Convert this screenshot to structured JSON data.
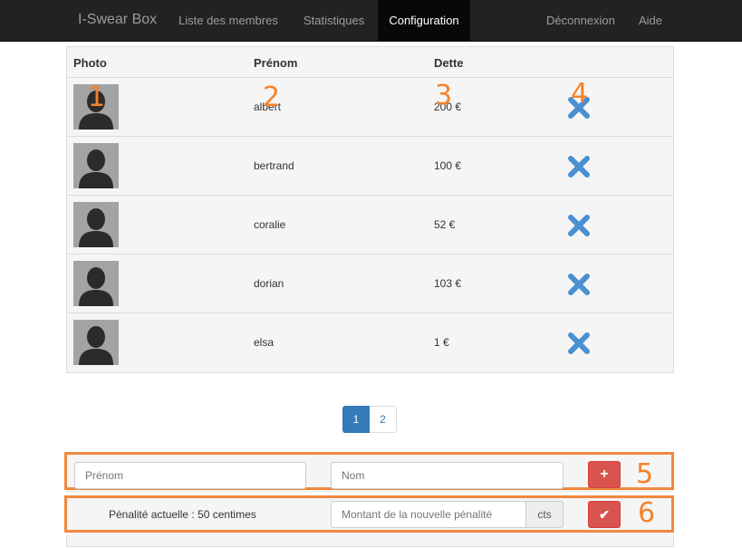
{
  "navbar": {
    "brand": "I-Swear Box",
    "items": [
      "Liste des membres",
      "Statistiques",
      "Configuration"
    ],
    "active": "Configuration",
    "right_items": [
      "Déconnexion",
      "Aide"
    ]
  },
  "table": {
    "headers": [
      "Photo",
      "Prénom",
      "Dette"
    ],
    "rows": [
      {
        "name": "albert",
        "debt": "200 €"
      },
      {
        "name": "bertrand",
        "debt": "100 €"
      },
      {
        "name": "coralie",
        "debt": "52 €"
      },
      {
        "name": "dorian",
        "debt": "103 €"
      },
      {
        "name": "elsa",
        "debt": "1 €"
      }
    ]
  },
  "annotations": [
    "1",
    "2",
    "3",
    "4",
    "5",
    "6"
  ],
  "pagination": {
    "pages": [
      "1",
      "2"
    ],
    "current": "1"
  },
  "add_form": {
    "firstname_placeholder": "Prénom",
    "lastname_placeholder": "Nom",
    "submit_icon": "plus-icon",
    "submit_label": "+"
  },
  "penalty_form": {
    "current_label": "Pénalité actuelle : 50 centimes",
    "amount_placeholder": "Montant de la nouvelle pénalité",
    "unit": "cts",
    "submit_icon": "check-icon",
    "submit_label": "✔"
  },
  "colors": {
    "navbar_bg": "#222222",
    "accent_blue": "#337ab7",
    "delete_icon": "#4a90d2",
    "danger": "#d9534f",
    "annotation_orange": "#f5822a"
  }
}
